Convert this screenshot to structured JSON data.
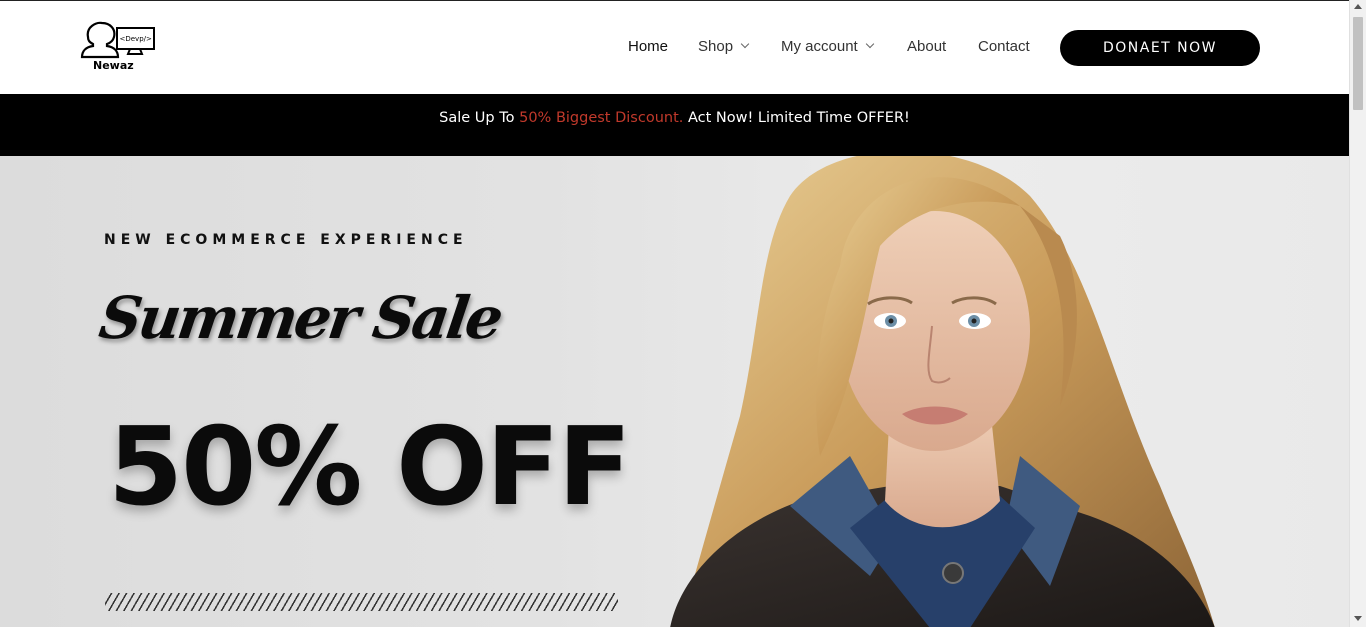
{
  "brand": {
    "logo_text": "Newaz",
    "logo_tag": "<Devp/>"
  },
  "nav": {
    "items": [
      {
        "label": "Home",
        "active": true,
        "dropdown": false
      },
      {
        "label": "Shop",
        "active": false,
        "dropdown": true
      },
      {
        "label": "My account",
        "active": false,
        "dropdown": true
      },
      {
        "label": "About",
        "active": false,
        "dropdown": false
      },
      {
        "label": "Contact",
        "active": false,
        "dropdown": false
      }
    ],
    "cta_label": "DONAET NOW"
  },
  "promo": {
    "prefix": "Sale Up To ",
    "highlight": "50% Biggest Discount.",
    "suffix": " Act Now! Limited Time OFFER!",
    "highlight_color": "#c0392b"
  },
  "hero": {
    "kicker": "NEW ECOMMERCE EXPERIENCE",
    "script_title": "Summer Sale",
    "headline": "50% OFF"
  }
}
